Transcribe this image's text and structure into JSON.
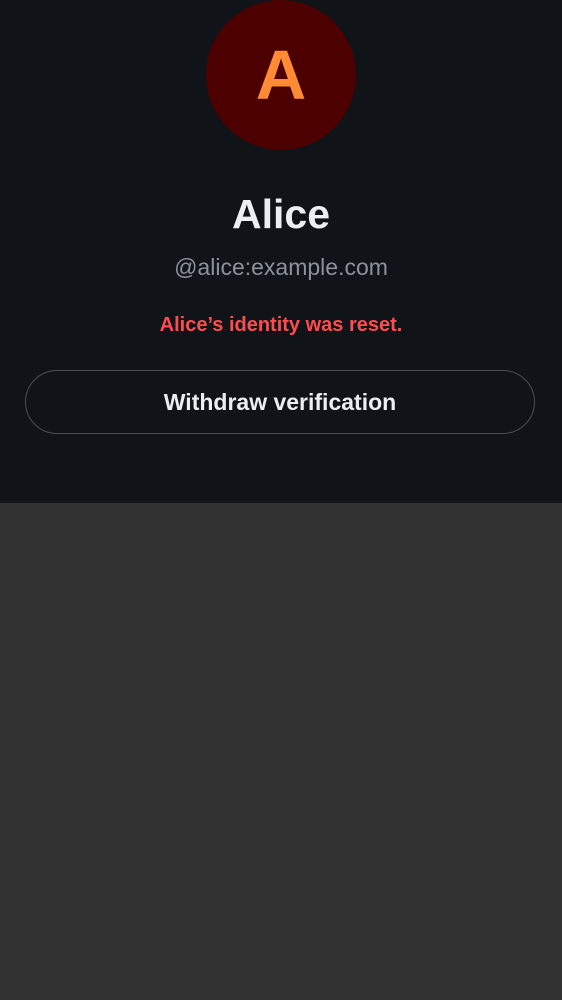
{
  "profile": {
    "avatar_initial": "A",
    "display_name": "Alice",
    "user_id": "@alice:example.com",
    "warning": "Alice’s identity was reset.",
    "withdraw_label": "Withdraw verification"
  },
  "colors": {
    "panel_background": "#101317",
    "page_background": "#323232",
    "avatar_background": "#4d0000",
    "avatar_initial": "#ff8c35",
    "warning_text": "#ff4c4f"
  }
}
